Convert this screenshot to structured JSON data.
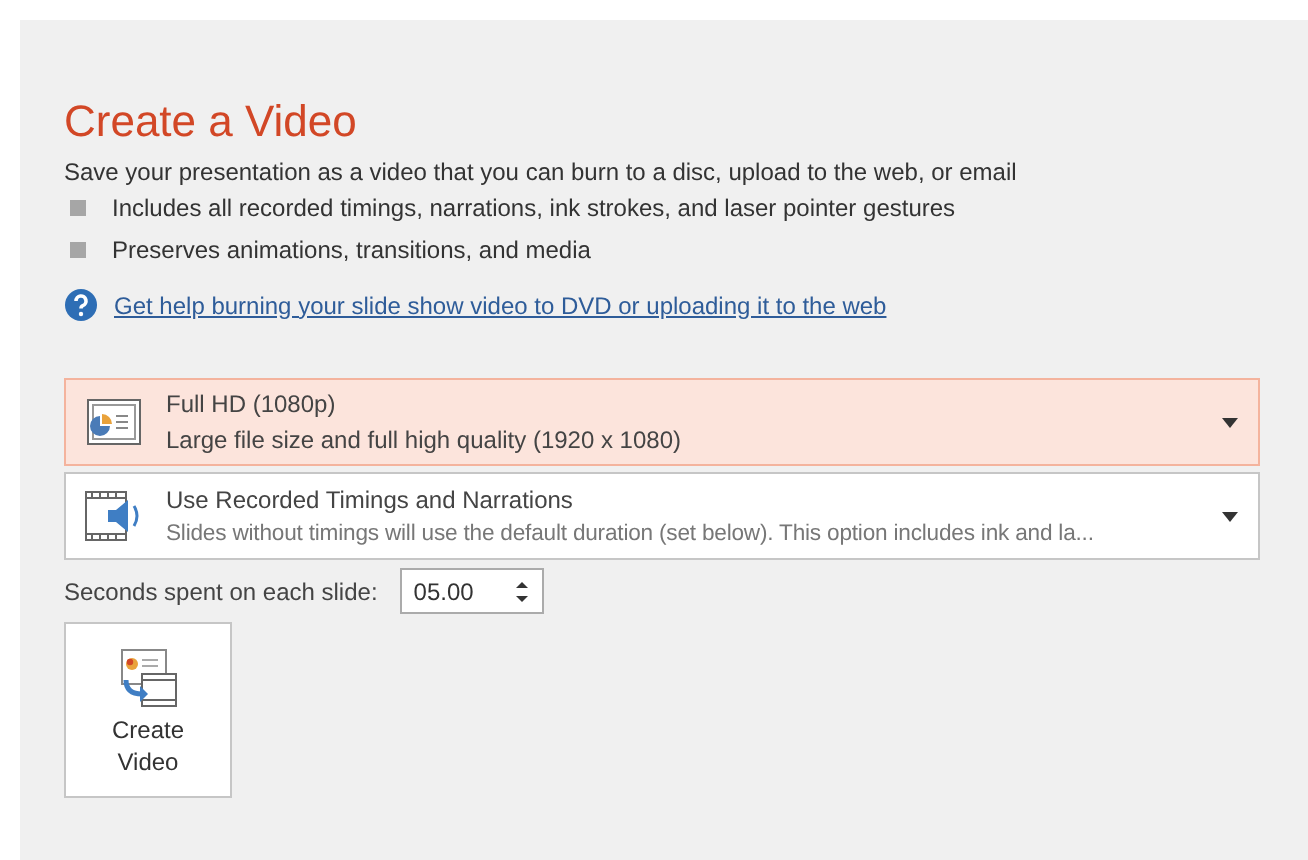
{
  "title": "Create a Video",
  "description": "Save your presentation as a video that you can burn to a disc, upload to the web, or email",
  "bullets": [
    "Includes all recorded timings, narrations, ink strokes, and laser pointer gestures",
    "Preserves animations, transitions, and media"
  ],
  "help_link": "Get help burning your slide show video to DVD or uploading it to the web",
  "dropdowns": [
    {
      "title": "Full HD (1080p)",
      "subtitle": "Large file size and full high quality (1920 x 1080)",
      "highlighted": true
    },
    {
      "title": "Use Recorded Timings and Narrations",
      "subtitle": "Slides without timings will use the default duration (set below). This option includes ink and la...",
      "highlighted": false
    }
  ],
  "seconds": {
    "label": "Seconds spent on each slide:",
    "value": "05.00"
  },
  "create_button": {
    "line_1": "Create",
    "line_2": "Video"
  }
}
